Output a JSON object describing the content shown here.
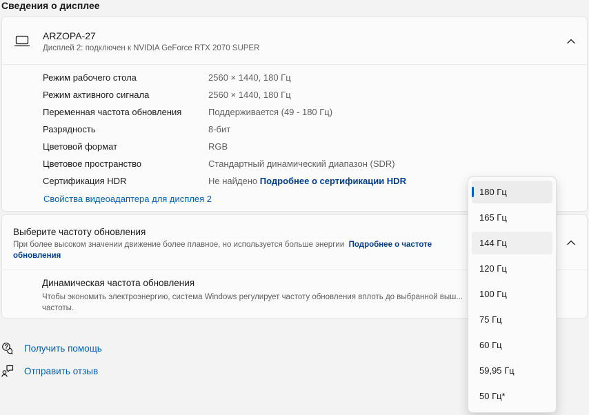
{
  "page": {
    "title": "Сведения о дисплее"
  },
  "display": {
    "name": "ARZOPA-27",
    "subtitle": "Дисплей 2: подключен к NVIDIA GeForce RTX 2070 SUPER",
    "rows": [
      {
        "label": "Режим рабочего стола",
        "value": "2560 × 1440, 180 Гц"
      },
      {
        "label": "Режим активного сигнала",
        "value": "2560 × 1440, 180 Гц"
      },
      {
        "label": "Переменная частота обновления",
        "value": "Поддерживается (49 - 180 Гц)"
      },
      {
        "label": "Разрядность",
        "value": "8-бит"
      },
      {
        "label": "Цветовой формат",
        "value": "RGB"
      },
      {
        "label": "Цветовое пространство",
        "value": "Стандартный динамический диапазон (SDR)"
      },
      {
        "label": "Сертификация HDR",
        "value": "Не найдено",
        "link": "Подробнее о сертификации HDR"
      }
    ],
    "adapter_link": "Свойства видеоадаптера для дисплея 2"
  },
  "refresh": {
    "title": "Выберите частоту обновления",
    "description": "При более высоком значении движение более плавное, но используется больше энергии",
    "link": "Подробнее о частоте обновления",
    "dynamic_title": "Динамическая частота обновления",
    "dynamic_desc": "Чтобы экономить электроэнергию, система Windows регулирует частоту обновления вплоть до выбранной выш... частоты."
  },
  "dropdown": {
    "selected": "180 Гц",
    "items": [
      "180 Гц",
      "165 Гц",
      "144 Гц",
      "120 Гц",
      "100 Гц",
      "75 Гц",
      "60 Гц",
      "59,95 Гц",
      "50 Гц*"
    ]
  },
  "footer": {
    "help": "Получить помощь",
    "feedback": "Отправить отзыв"
  },
  "icons": {
    "display": "monitor-icon",
    "collapse": "chevron-up-icon",
    "help": "help-chat-icon",
    "feedback": "feedback-person-icon"
  },
  "colors": {
    "accent": "#005fb8",
    "link_bold": "#003e92"
  }
}
